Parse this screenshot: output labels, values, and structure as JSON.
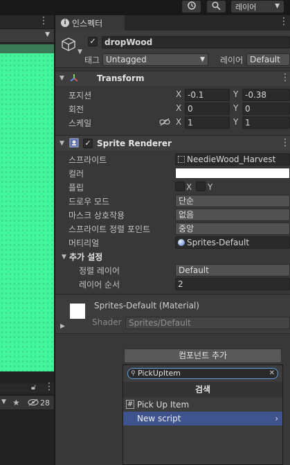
{
  "toolbar": {
    "layer_label": "레이어"
  },
  "left_panel": {
    "favorites_count": "28"
  },
  "inspector": {
    "tab_label": "인스펙터",
    "object_name": "dropWood",
    "tag_label": "태그",
    "tag_value": "Untagged",
    "layer_label": "레이어",
    "layer_value": "Default",
    "transform": {
      "title": "Transform",
      "position_label": "포지션",
      "rotation_label": "회전",
      "scale_label": "스케일",
      "x_axis": "X",
      "y_axis": "Y",
      "position_x": "-0.1",
      "position_y": "-0.38",
      "rotation_x": "0",
      "rotation_y": "0",
      "scale_x": "1",
      "scale_y": "1"
    },
    "sprite_renderer": {
      "title": "Sprite Renderer",
      "sprite_label": "스프라이트",
      "sprite_value": "NeedieWood_Harvest",
      "color_label": "컬러",
      "flip_label": "플립",
      "flip_x": "X",
      "flip_y": "Y",
      "draw_mode_label": "드로우 모드",
      "draw_mode_value": "단순",
      "mask_label": "마스크 상호작용",
      "mask_value": "없음",
      "pivot_label": "스프라이트 정렬 포인트",
      "pivot_value": "중앙",
      "material_label": "머티리얼",
      "material_value": "Sprites-Default",
      "additional_label": "추가 설정",
      "sorting_layer_label": "정렬 레이어",
      "sorting_layer_value": "Default",
      "order_label": "레이어 순서",
      "order_value": "2"
    },
    "material": {
      "title": "Sprites-Default (Material)",
      "shader_label": "Shader",
      "shader_value": "Sprites/Default"
    },
    "add_component_label": "컴포넌트 추가"
  },
  "popup": {
    "search_value": "PickUpItem",
    "title": "검색",
    "items": [
      {
        "label": "Pick Up Item"
      },
      {
        "label": "New script"
      }
    ]
  },
  "colors": {
    "selection": "#3f538f",
    "scene_green": "#43f59b",
    "panel": "#383838"
  }
}
